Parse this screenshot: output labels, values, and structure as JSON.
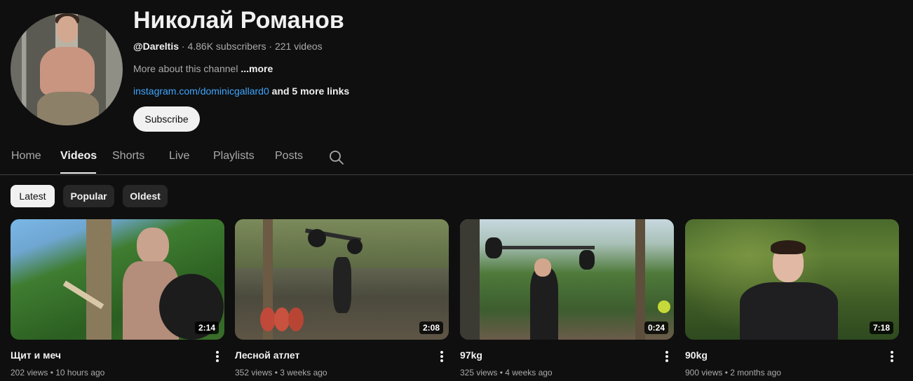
{
  "channel": {
    "name": "Николай Романов",
    "handle": "@Dareltis",
    "stats": " · 4.86K subscribers · 221 videos",
    "about_text": "More about this channel ",
    "about_more": "...more",
    "link": "instagram.com/dominicgallard0",
    "more_links": " and 5 more links",
    "subscribe_label": "Subscribe"
  },
  "tabs": [
    {
      "label": "Home"
    },
    {
      "label": "Videos"
    },
    {
      "label": "Shorts"
    },
    {
      "label": "Live"
    },
    {
      "label": "Playlists"
    },
    {
      "label": "Posts"
    }
  ],
  "active_tab": "Videos",
  "filters": [
    {
      "label": "Latest"
    },
    {
      "label": "Popular"
    },
    {
      "label": "Oldest"
    }
  ],
  "active_filter": "Latest",
  "videos": [
    {
      "title": "Щит и меч",
      "duration": "2:14",
      "meta": "202 views • 10 hours ago"
    },
    {
      "title": "Лесной атлет",
      "duration": "2:08",
      "meta": "352 views • 3 weeks ago"
    },
    {
      "title": "97kg",
      "duration": "0:24",
      "meta": "325 views • 4 weeks ago"
    },
    {
      "title": "90kg",
      "duration": "7:18",
      "meta": "900 views • 2 months ago"
    }
  ],
  "colors": {
    "background": "#0f0f0f",
    "link": "#3ea6ff",
    "text_primary": "#f1f1f1",
    "text_secondary": "#aaaaaa"
  }
}
